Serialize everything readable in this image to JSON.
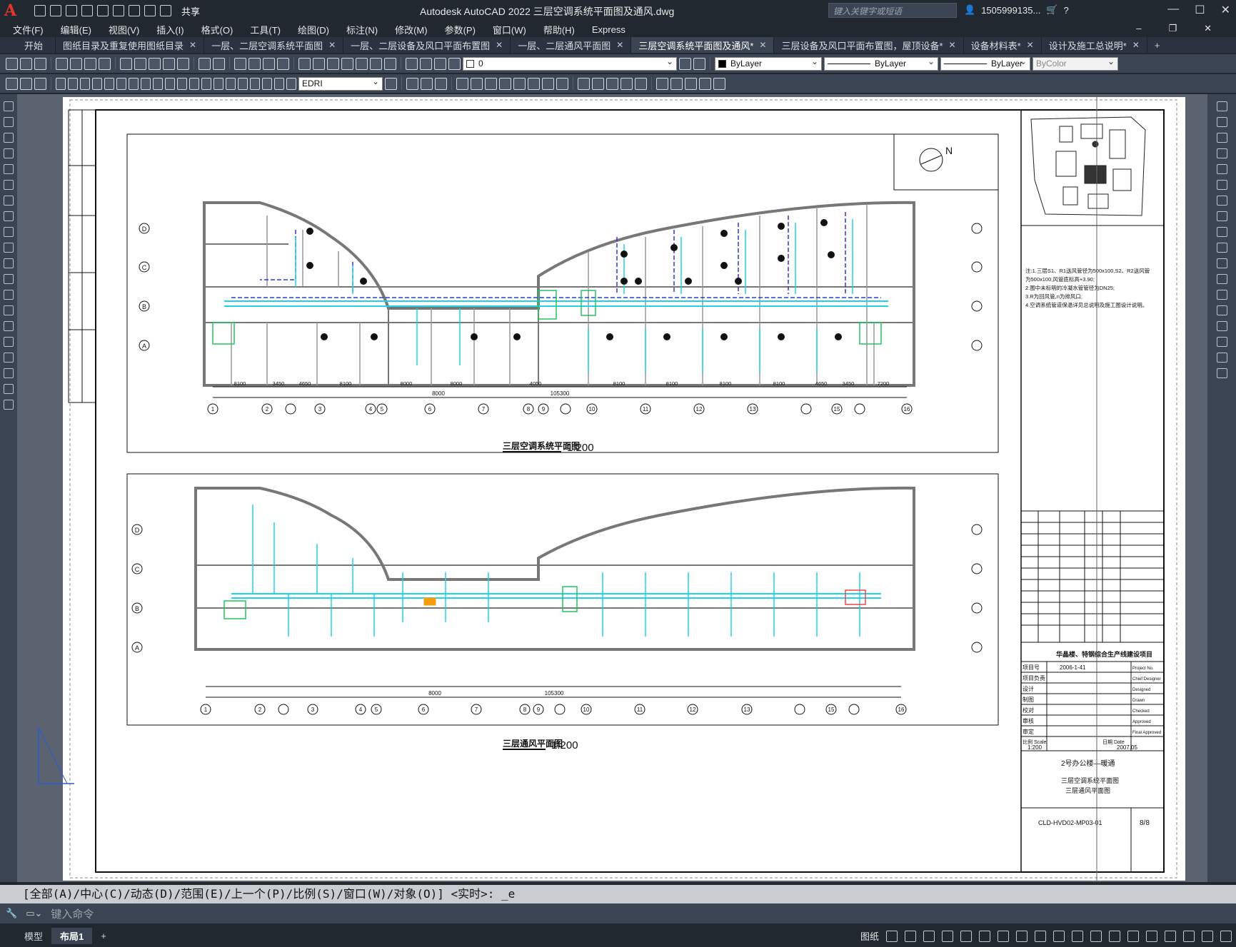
{
  "app": {
    "title": "Autodesk AutoCAD 2022    三层空调系统平面图及通风.dwg",
    "share": "共享",
    "search_placeholder": "键入关键字或短语",
    "user": "1505999135..."
  },
  "menu": [
    "文件(F)",
    "编辑(E)",
    "视图(V)",
    "插入(I)",
    "格式(O)",
    "工具(T)",
    "绘图(D)",
    "标注(N)",
    "修改(M)",
    "参数(P)",
    "窗口(W)",
    "帮助(H)",
    "Express"
  ],
  "tabs": [
    {
      "label": "开始",
      "active": false,
      "closable": false
    },
    {
      "label": "图纸目录及重复使用图纸目录",
      "active": false,
      "closable": true
    },
    {
      "label": "一层、二层空调系统平面图",
      "active": false,
      "closable": true
    },
    {
      "label": "一层、二层设备及风口平面布置图",
      "active": false,
      "closable": true
    },
    {
      "label": "一层、二层通风平面图",
      "active": false,
      "closable": true
    },
    {
      "label": "三层空调系统平面图及通风*",
      "active": true,
      "closable": true
    },
    {
      "label": "三层设备及风口平面布置图，屋顶设备*",
      "active": false,
      "closable": true
    },
    {
      "label": "设备材料表*",
      "active": false,
      "closable": true
    },
    {
      "label": "设计及施工总说明*",
      "active": false,
      "closable": true
    }
  ],
  "properties": {
    "layer": "0",
    "color": "ByLayer",
    "linetype": "ByLayer",
    "lineweight": "ByLayer",
    "plotstyle": "ByColor",
    "dimstyle": "EDRI"
  },
  "drawing": {
    "plan1_title": "三层空调系统平面图",
    "plan2_title": "三层通风平面图",
    "scale": "1:200",
    "north": "N",
    "overall_dim": "105300",
    "sub_dim": "8000",
    "dims": [
      "8100",
      "3450",
      "4650",
      "8100",
      "8000",
      "8000",
      "4050",
      "8100",
      "4050",
      "8100",
      "8100",
      "8100",
      "8100",
      "8100",
      "4650",
      "3450",
      "7200"
    ],
    "grid_nums": [
      "1",
      "2",
      "1/2",
      "3",
      "4",
      "5",
      "6",
      "7",
      "8",
      "9",
      "1/9",
      "10",
      "11",
      "12",
      "13",
      "14",
      "1/14",
      "15",
      "16"
    ],
    "grid_letters": [
      "D",
      "C",
      "B",
      "A"
    ],
    "notes": [
      "注:1.三层S1、R1送风管径为500x100,S2、R2送风管",
      "  为500x100,风管底标高+3.90;",
      "2.图中未标明的冷凝水管管径为DN25;",
      "3.R为回风管,n为排风口;",
      "4.空调系统管道保温详见总说明及施工图设计说明。"
    ],
    "project": "华晶楼、特钢综合生产线建设项目",
    "project_no": "2006-1-41",
    "building": "2号办公楼—暖通",
    "sheet_title_1": "三层空调系统平面图",
    "sheet_title_2": "三层通风平面图",
    "scale_val": "1:200",
    "date": "2007.05",
    "drawing_no": "CLD-HVD02-MP03-01",
    "sheet_no": "8/8",
    "tb_labels": [
      "项目号",
      "项目负责",
      "设计",
      "制图",
      "校对",
      "审核",
      "审定",
      "比例 Scale",
      "日期 Date"
    ],
    "tb_en": [
      "Project No.",
      "Chief Designer",
      "Designed",
      "Drawn",
      "Checked",
      "Approved",
      "Final Approved"
    ]
  },
  "command": {
    "prompt": "[全部(A)/中心(C)/动态(D)/范围(E)/上一个(P)/比例(S)/窗口(W)/对象(O)] <实时>: _e",
    "placeholder": "键入命令"
  },
  "layouts": {
    "model": "模型",
    "layout1": "布局1",
    "paper": "图纸"
  }
}
